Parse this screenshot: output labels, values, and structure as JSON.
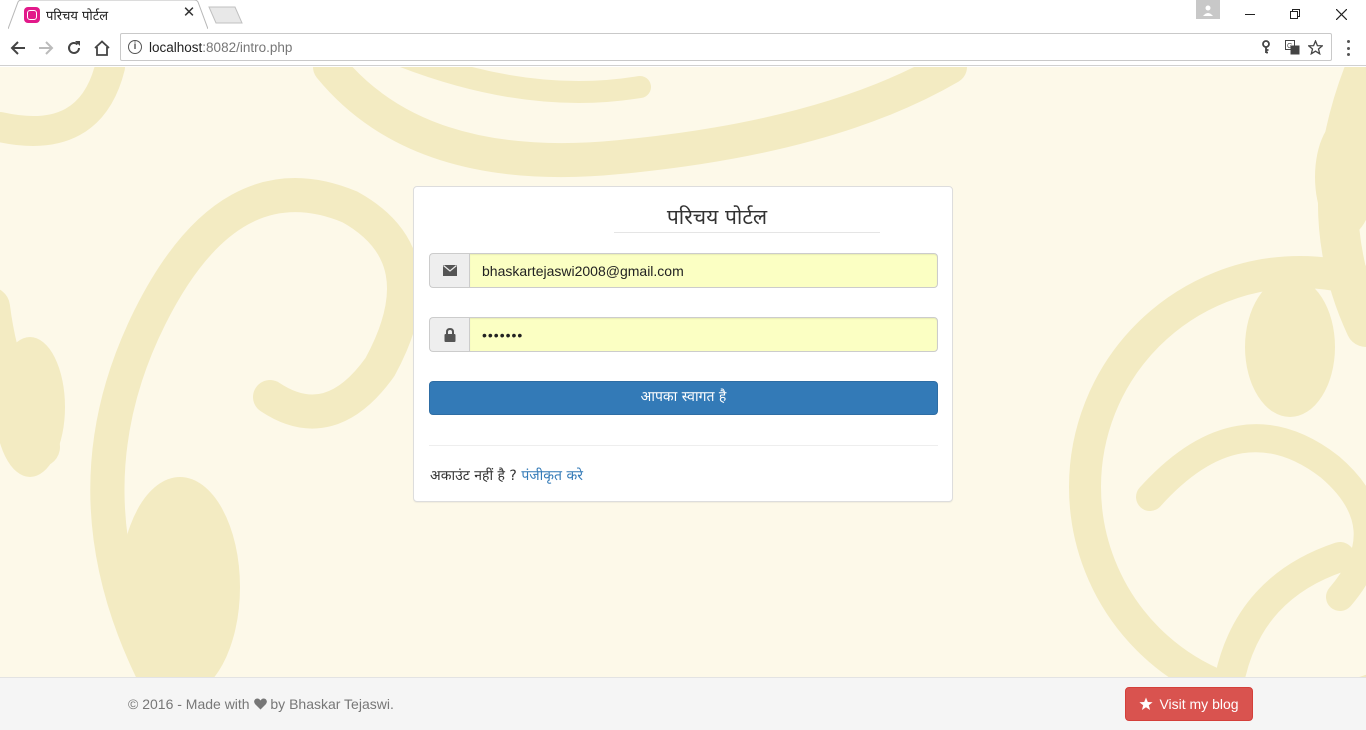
{
  "browser": {
    "tab_title": "परिचय पोर्टल",
    "url_host": "localhost",
    "url_rest": ":8082/intro.php"
  },
  "login": {
    "title": "परिचय पोर्टल",
    "email_value": "bhaskartejaswi2008@gmail.com",
    "password_value": "•••••••",
    "submit_label": "आपका स्वागत है",
    "no_account_text": "अकाउंट नहीं है ?",
    "register_link": "पंजीकृत करे"
  },
  "footer": {
    "copyright_prefix": "© 2016 - Made with",
    "copyright_suffix": "by Bhaskar Tejaswi.",
    "blog_button": "Visit my blog"
  },
  "colors": {
    "primary": "#337ab7",
    "danger": "#d9534f",
    "autofill": "#fbffc3",
    "page_bg": "#fdf9e9"
  }
}
